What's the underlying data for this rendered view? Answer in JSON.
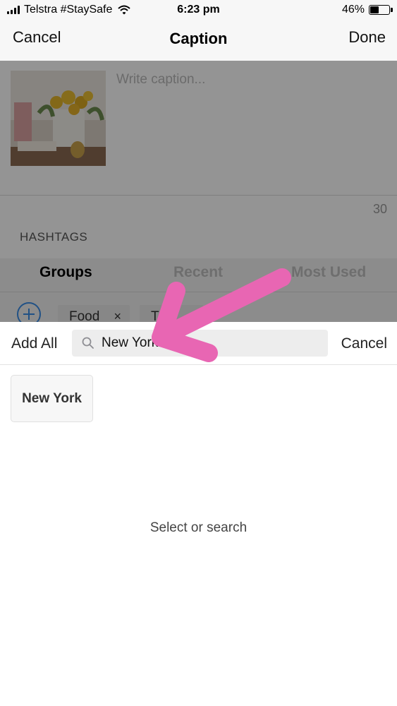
{
  "status_bar": {
    "carrier": "Telstra #StaySafe",
    "time": "6:23 pm",
    "battery": "46%",
    "battery_level": 0.46
  },
  "nav": {
    "cancel": "Cancel",
    "title": "Caption",
    "done": "Done"
  },
  "editor": {
    "caption_placeholder": "Write caption...",
    "char_count": "30",
    "hashtags_label": "HASHTAGS",
    "tabs": [
      "Groups",
      "Recent",
      "Most Used"
    ],
    "active_tab": "Groups",
    "chips": [
      "Food",
      "Tr"
    ]
  },
  "search": {
    "add_all": "Add All",
    "value": "New York",
    "cancel": "Cancel"
  },
  "results": {
    "items": [
      "New York"
    ],
    "hint": "Select or search"
  },
  "colors": {
    "accent": "#3a8ce6",
    "annotation_arrow": "#e866b3"
  }
}
